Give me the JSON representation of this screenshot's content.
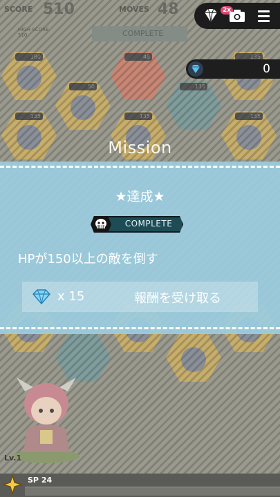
{
  "hud": {
    "score_label": "SCORE",
    "score_value": "510",
    "moves_label": "MOVES",
    "moves_value": "48",
    "high_score_label": "HIGH SCORE",
    "high_score_value": "510",
    "complete_text": "COMPLETE"
  },
  "toolbar": {
    "gem_multiplier": "2x",
    "icons": [
      "diamond-icon",
      "camera-icon",
      "menu-icon"
    ]
  },
  "gems": {
    "count": "0",
    "icon": "diamond-icon"
  },
  "board_badges": [
    "180",
    "50",
    "48",
    "135",
    "135",
    "135",
    "135",
    "135"
  ],
  "mission": {
    "title": "Mission",
    "status": "★達成★",
    "complete_tag": "COMPLETE",
    "description": "HPが150以上の敵を倒す",
    "reward": {
      "icon": "diamond-icon",
      "quantity": "x 15",
      "button_label": "報酬を受け取る"
    }
  },
  "character": {
    "level_label": "Lv.1"
  },
  "skill": {
    "sp_label": "SP 24",
    "icon": "star-icon"
  },
  "colors": {
    "panel": "#9bcde1",
    "complete_tag": "#1e4c56",
    "badge": "#e0476f"
  }
}
